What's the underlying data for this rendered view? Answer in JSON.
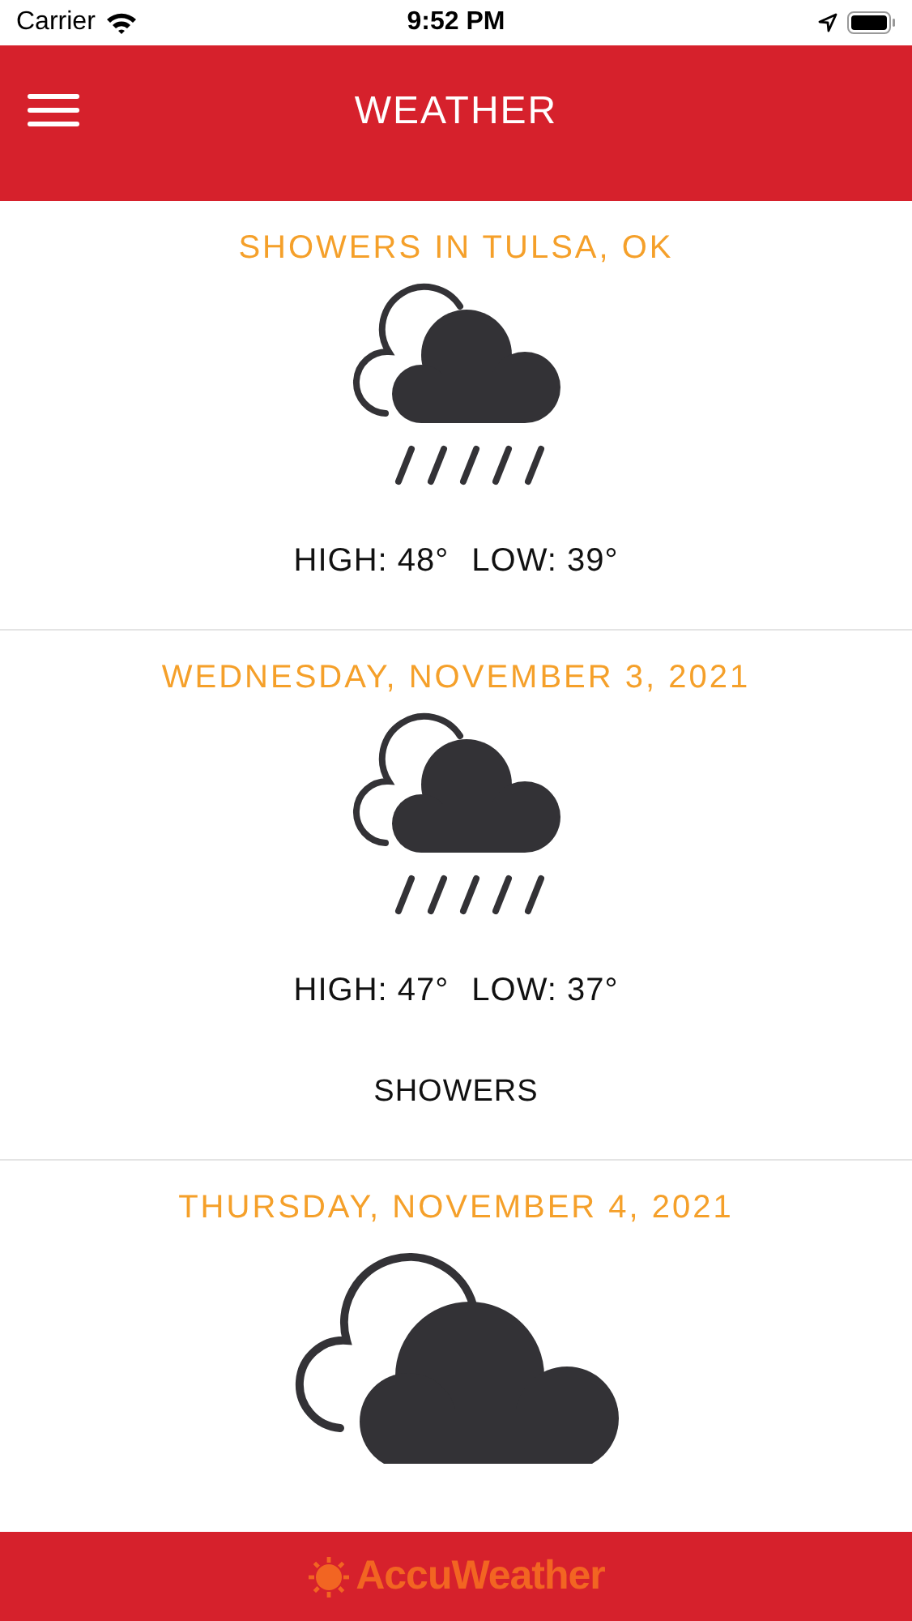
{
  "status_bar": {
    "carrier": "Carrier",
    "time": "9:52 PM"
  },
  "header": {
    "title": "WEATHER"
  },
  "forecasts": [
    {
      "title": "SHOWERS IN TULSA, OK",
      "kind": "rain",
      "high": "HIGH: 48°",
      "low": "LOW: 39°"
    },
    {
      "title": "WEDNESDAY, NOVEMBER 3, 2021",
      "kind": "rain",
      "high": "HIGH: 47°",
      "low": "LOW: 37°",
      "condition": "SHOWERS"
    },
    {
      "title": "THURSDAY, NOVEMBER 4, 2021",
      "kind": "cloudy"
    }
  ],
  "footer": {
    "logo": "AccuWeather"
  }
}
